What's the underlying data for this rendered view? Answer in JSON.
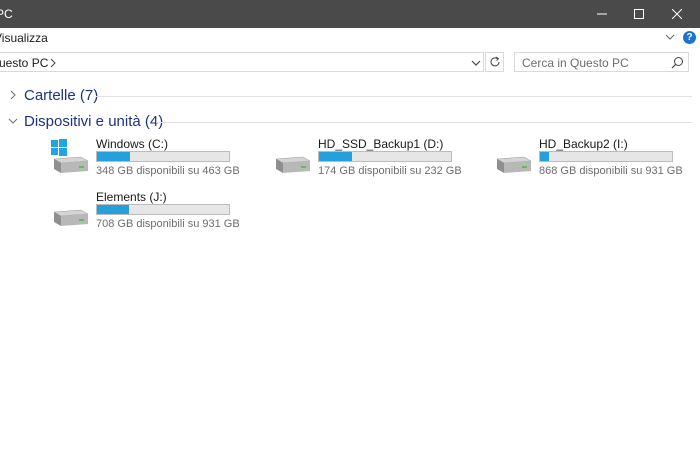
{
  "window": {
    "title": "PC"
  },
  "ribbon": {
    "tab_visualizza": "Visualizza",
    "help_label": "?"
  },
  "address": {
    "path": "uesto PC",
    "search_placeholder": "Cerca in Questo PC"
  },
  "groups": {
    "cartelle": "Cartelle (7)",
    "dispositivi": "Dispositivi e unità (4)"
  },
  "drives": [
    {
      "name": "Windows (C:)",
      "space": "348 GB disponibili su 463 GB",
      "used_fraction": 0.25,
      "icon": "windows-drive-icon"
    },
    {
      "name": "HD_SSD_Backup1 (D:)",
      "space": "174 GB disponibili su 232 GB",
      "used_fraction": 0.25,
      "icon": "drive-icon"
    },
    {
      "name": "HD_Backup2 (I:)",
      "space": "868 GB disponibili su 931 GB",
      "used_fraction": 0.07,
      "icon": "drive-icon"
    },
    {
      "name": "Elements (J:)",
      "space": "708 GB disponibili su 931 GB",
      "used_fraction": 0.24,
      "icon": "drive-icon"
    }
  ],
  "colors": {
    "titlebar": "#4a4a4a",
    "accent": "#26a0da",
    "group_title": "#1e3287"
  }
}
